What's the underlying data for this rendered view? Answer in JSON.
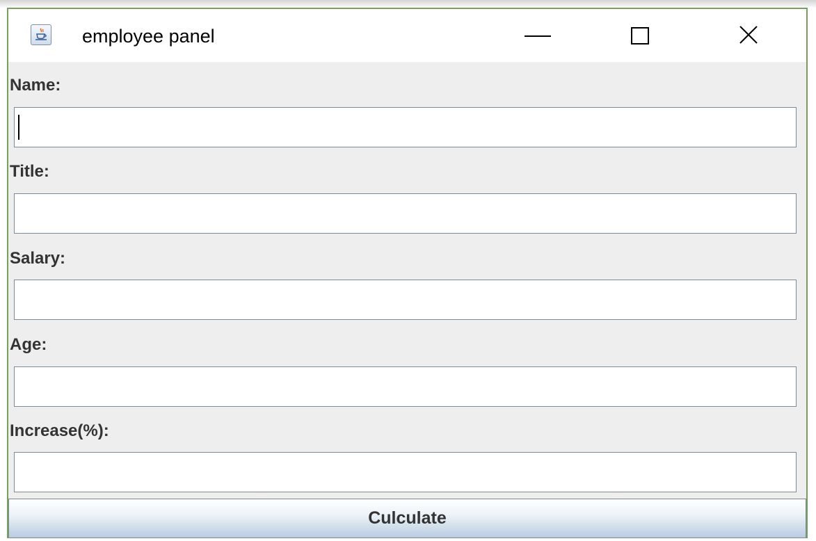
{
  "window": {
    "title": "employee panel",
    "icon": "java-cup-icon",
    "controls": {
      "minimize": "minimize-icon",
      "maximize": "maximize-icon",
      "close": "close-icon"
    }
  },
  "form": {
    "fields": [
      {
        "label": "Name:",
        "value": "",
        "focused": true
      },
      {
        "label": "Title:",
        "value": "",
        "focused": false
      },
      {
        "label": "Salary:",
        "value": "",
        "focused": false
      },
      {
        "label": "Age:",
        "value": "",
        "focused": false
      },
      {
        "label": "Increase(%):",
        "value": "",
        "focused": false
      }
    ],
    "calculate_label": "Culculate"
  },
  "colors": {
    "window_border": "#74a15c",
    "panel_background": "#eeeeee",
    "titlebar_background": "#ffffff",
    "button_gradient_bottom": "#b9cce0"
  }
}
